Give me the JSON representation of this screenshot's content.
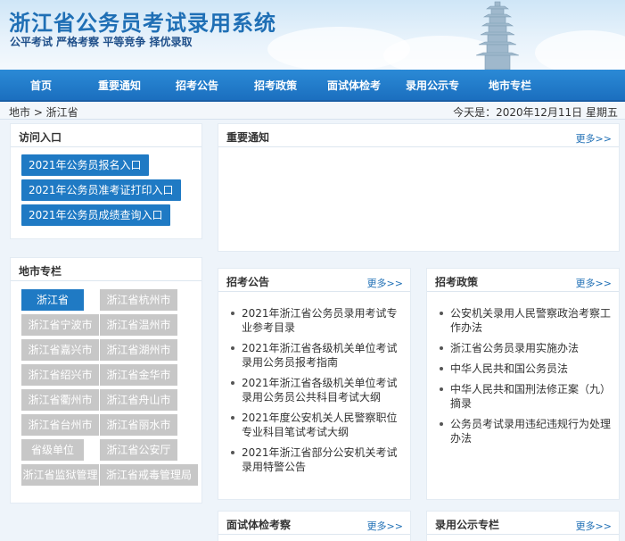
{
  "header": {
    "title": "浙江省公务员考试录用系统",
    "slogan": "公平考试 严格考察 平等竞争 择优录取"
  },
  "nav": {
    "items": [
      "首页",
      "重要通知",
      "招考公告",
      "招考政策",
      "面试体检考",
      "录用公示专",
      "地市专栏"
    ]
  },
  "breadcrumb": {
    "text": "地市 > 浙江省",
    "date": "今天是：2020年12月11日 星期五"
  },
  "access": {
    "title": "访问入口",
    "buttons": [
      "2021年公务员报名入口",
      "2021年公务员准考证打印入口",
      "2021年公务员成绩查询入口"
    ]
  },
  "cities": {
    "title": "地市专栏",
    "items": [
      "浙江省",
      "浙江省杭州市",
      "浙江省宁波市",
      "浙江省温州市",
      "浙江省嘉兴市",
      "浙江省湖州市",
      "浙江省绍兴市",
      "浙江省金华市",
      "浙江省衢州市",
      "浙江省舟山市",
      "浙江省台州市",
      "浙江省丽水市",
      "省级单位",
      "浙江省公安厅",
      "浙江省监狱管理",
      "浙江省戒毒管理局"
    ]
  },
  "notices": {
    "title": "重要通知",
    "more": "更多>>"
  },
  "recruit": {
    "title": "招考公告",
    "more": "更多>>",
    "items": [
      "2021年浙江省公务员录用考试专业参考目录",
      "2021年浙江省各级机关单位考试录用公务员报考指南",
      "2021年浙江省各级机关单位考试录用公务员公共科目考试大纲",
      "2021年度公安机关人民警察职位专业科目笔试考试大纲",
      "2021年浙江省部分公安机关考试录用特警公告"
    ]
  },
  "policy": {
    "title": "招考政策",
    "more": "更多>>",
    "items": [
      "公安机关录用人民警察政治考察工作办法",
      "浙江省公务员录用实施办法",
      "中华人民共和国公务员法",
      "中华人民共和国刑法修正案（九）摘录",
      "公务员考试录用违纪违规行为处理办法"
    ]
  },
  "interview": {
    "title": "面试体检考察",
    "more": "更多>>"
  },
  "publicity": {
    "title": "录用公示专栏",
    "more": "更多>>"
  },
  "colors": {
    "primary": "#1f7ac4",
    "nav": "#2b8ad6",
    "inactive": "#c7c7c7"
  }
}
